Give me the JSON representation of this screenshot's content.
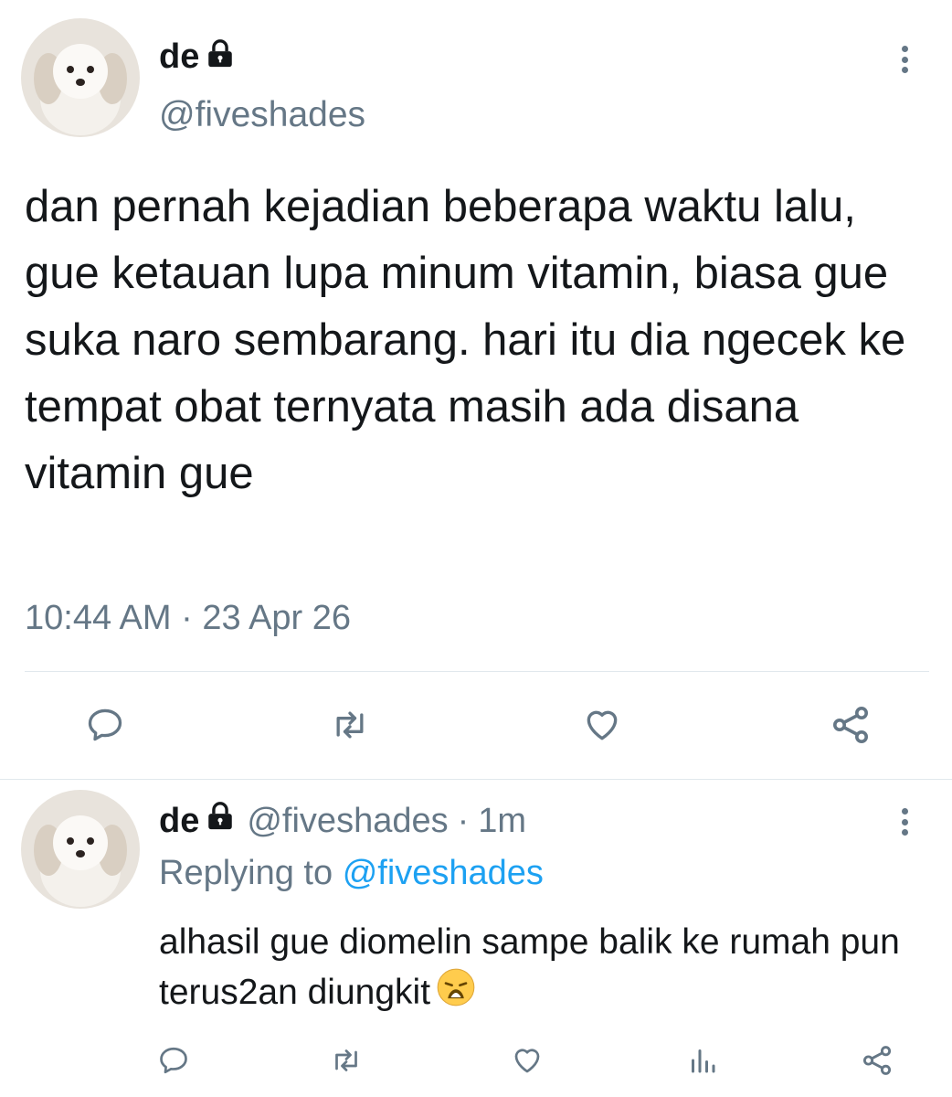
{
  "tweet": {
    "display_name": "de",
    "handle": "@fiveshades",
    "text": "dan pernah kejadian beberapa waktu lalu, gue ketauan lupa minum vitamin, biasa gue suka naro sembarang. hari itu dia ngecek ke tempat obat ternyata masih ada disana vitamin gue",
    "time": "10:44 AM",
    "date_separator": "·",
    "date": "23 Apr 26"
  },
  "reply": {
    "display_name": "de",
    "handle": "@fiveshades",
    "separator": "·",
    "age": "1m",
    "replying_prefix": "Replying to",
    "replying_to": "@fiveshades",
    "text": "alhasil gue diomelin sampe balik ke rumah pun terus2an diungkit"
  },
  "icons": {
    "lock": "lock-icon",
    "more": "more-vertical-icon",
    "reply": "reply-icon",
    "retweet": "retweet-icon",
    "like": "heart-icon",
    "share": "share-icon",
    "analytics": "analytics-icon",
    "emoji": "weary-face-emoji"
  },
  "colors": {
    "text_primary": "#14171a",
    "text_secondary": "#657786",
    "link": "#1da1f2",
    "divider": "#e1e8ed"
  }
}
